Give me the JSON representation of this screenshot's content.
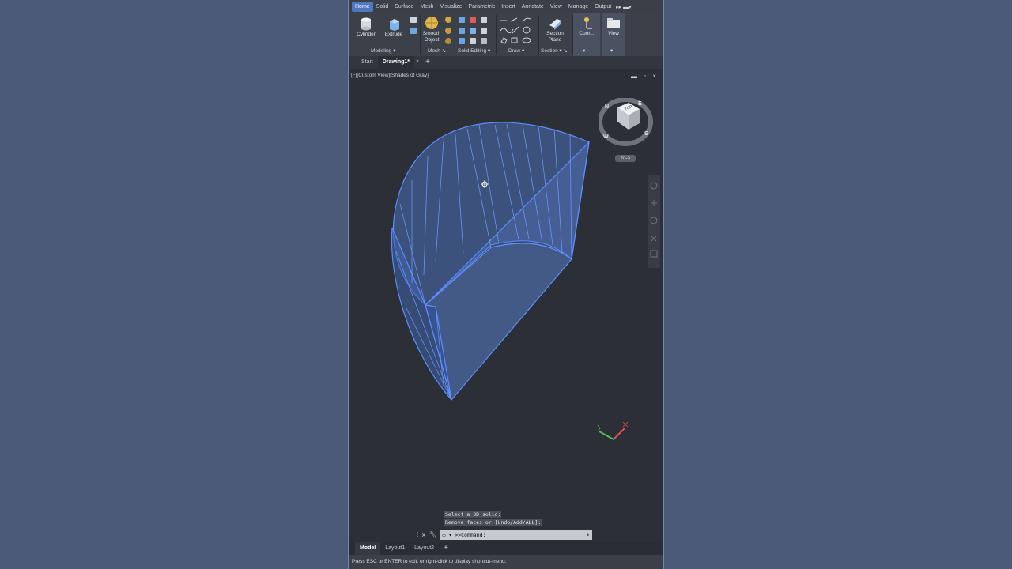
{
  "ribbon": {
    "tabs": [
      "Home",
      "Solid",
      "Surface",
      "Mesh",
      "Visualize",
      "Parametric",
      "Insert",
      "Annotate",
      "View",
      "Manage",
      "Output"
    ],
    "active_tab": "Home",
    "buttons": {
      "cylinder": "Cylinder",
      "extrude": "Extrude",
      "smooth_object_1": "Smooth",
      "smooth_object_2": "Object",
      "section_plane_1": "Section",
      "section_plane_2": "Plane",
      "coordinates": "Coor...",
      "view": "View"
    },
    "panels": {
      "modeling": "Modeling",
      "mesh": "Mesh",
      "solid_editing": "Solid Editing",
      "draw": "Draw",
      "section": "Section"
    }
  },
  "doc_tabs": {
    "start": "Start",
    "drawing": "Drawing1*",
    "close": "×",
    "add": "+"
  },
  "viewport": {
    "label": "[−][Custom View][Shades of Gray]",
    "controls": "▬ ▫ ×",
    "viewcube": {
      "top": "TOP",
      "north": "N",
      "south": "S",
      "east": "E",
      "west": "W",
      "ucs": "WCS"
    }
  },
  "command": {
    "history": [
      "Select a 3D solid:",
      "Remove faces or [Undo/Add/ALL]:"
    ],
    "input": "▭ ▾ >>Command:"
  },
  "layout_tabs": {
    "model": "Model",
    "layout1": "Layout1",
    "layout2": "Layout2",
    "add": "+"
  },
  "status_text": "Press ESC or ENTER to exit, or right-click to display shortcut-menu.",
  "colors": {
    "accent": "#4f78c4",
    "selection": "#5b8dff",
    "background": "#4a5a78"
  }
}
